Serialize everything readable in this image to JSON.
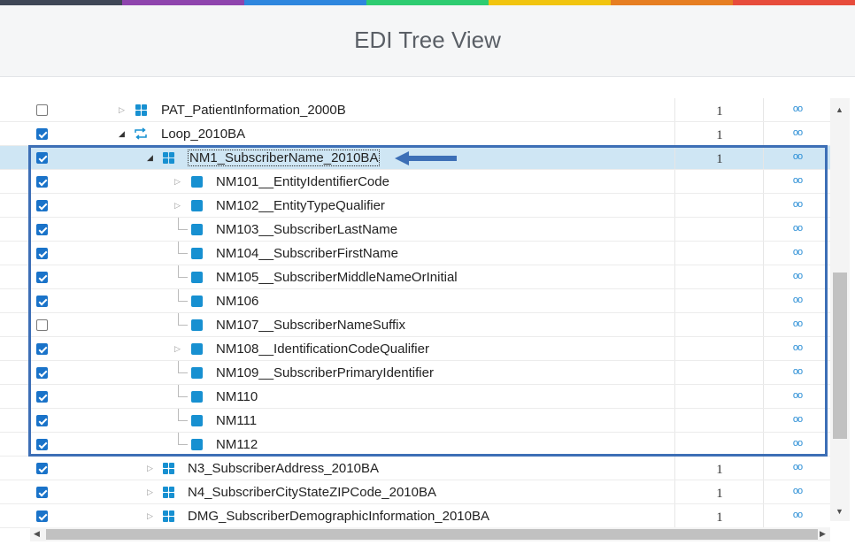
{
  "colors": {
    "top_bar": [
      "#3f4756",
      "#8e44ad",
      "#2e86de",
      "#2ecc71",
      "#f1c40f",
      "#e67e22",
      "#e74c3c"
    ],
    "accent": "#1790d1",
    "checkbox": "#1a73c9",
    "selected_row": "#cfe6f4",
    "highlight_box": "#3d6fb6"
  },
  "header": {
    "title": "EDI Tree View"
  },
  "tree": {
    "rows": [
      {
        "label": "PAT_PatientInformation_2000B",
        "checked": false,
        "icon": "segment-grid-icon",
        "expander": "collapsed",
        "count": "1",
        "link": "oo"
      },
      {
        "label": "Loop_2010BA",
        "checked": true,
        "icon": "loop-icon",
        "expander": "expanded",
        "count": "1",
        "link": "oo"
      },
      {
        "label": "NM1_SubscriberName_2010BA",
        "checked": true,
        "icon": "segment-grid-icon",
        "expander": "expanded",
        "count": "1",
        "link": "oo",
        "selected": true
      },
      {
        "label": "NM101__EntityIdentifierCode",
        "checked": true,
        "icon": "element-square-icon",
        "expander": "collapsed",
        "count": "",
        "link": "oo"
      },
      {
        "label": "NM102__EntityTypeQualifier",
        "checked": true,
        "icon": "element-square-icon",
        "expander": "collapsed",
        "count": "",
        "link": "oo"
      },
      {
        "label": "NM103__SubscriberLastName",
        "checked": true,
        "icon": "element-square-icon",
        "expander": "leaf",
        "count": "",
        "link": "oo"
      },
      {
        "label": "NM104__SubscriberFirstName",
        "checked": true,
        "icon": "element-square-icon",
        "expander": "leaf",
        "count": "",
        "link": "oo"
      },
      {
        "label": "NM105__SubscriberMiddleNameOrInitial",
        "checked": true,
        "icon": "element-square-icon",
        "expander": "leaf",
        "count": "",
        "link": "oo"
      },
      {
        "label": "NM106",
        "checked": true,
        "icon": "element-square-icon",
        "expander": "leaf",
        "count": "",
        "link": "oo"
      },
      {
        "label": "NM107__SubscriberNameSuffix",
        "checked": false,
        "icon": "element-square-icon",
        "expander": "leaf",
        "count": "",
        "link": "oo"
      },
      {
        "label": "NM108__IdentificationCodeQualifier",
        "checked": true,
        "icon": "element-square-icon",
        "expander": "collapsed",
        "count": "",
        "link": "oo"
      },
      {
        "label": "NM109__SubscriberPrimaryIdentifier",
        "checked": true,
        "icon": "element-square-icon",
        "expander": "leaf",
        "count": "",
        "link": "oo"
      },
      {
        "label": "NM110",
        "checked": true,
        "icon": "element-square-icon",
        "expander": "leaf",
        "count": "",
        "link": "oo"
      },
      {
        "label": "NM111",
        "checked": true,
        "icon": "element-square-icon",
        "expander": "leaf",
        "count": "",
        "link": "oo"
      },
      {
        "label": "NM112",
        "checked": true,
        "icon": "element-square-icon",
        "expander": "leaf",
        "count": "",
        "link": "oo"
      },
      {
        "label": "N3_SubscriberAddress_2010BA",
        "checked": true,
        "icon": "segment-grid-icon",
        "expander": "collapsed",
        "count": "1",
        "link": "oo"
      },
      {
        "label": "N4_SubscriberCityStateZIPCode_2010BA",
        "checked": true,
        "icon": "segment-grid-icon",
        "expander": "collapsed",
        "count": "1",
        "link": "oo"
      },
      {
        "label": "DMG_SubscriberDemographicInformation_2010BA",
        "checked": true,
        "icon": "segment-grid-icon",
        "expander": "collapsed",
        "count": "1",
        "link": "oo"
      }
    ]
  },
  "scrollbars": {
    "up": "▲",
    "down": "▼",
    "left": "◀",
    "right": "▶"
  }
}
